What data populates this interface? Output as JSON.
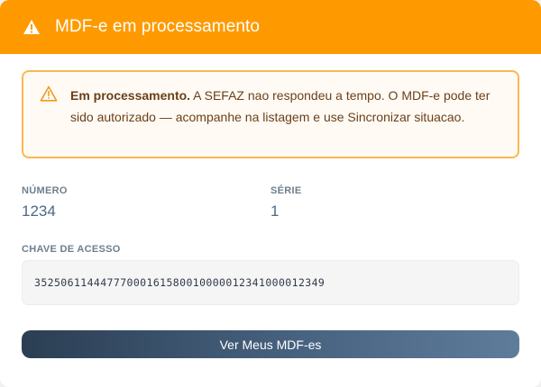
{
  "modal": {
    "title": "MDF-e em processamento",
    "header_icon": "warning-triangle-icon",
    "header_color": "#fe9a00"
  },
  "alert": {
    "icon": "warning-triangle-icon",
    "bold_text": "Em processamento.",
    "message": " A SEFAZ nao respondeu a tempo. O MDF-e pode ter sido autorizado — acompanhe na listagem e use Sincronizar situacao."
  },
  "fields": {
    "numero_label": "NÚMERO",
    "numero_value": "1234",
    "serie_label": "SÉRIE",
    "serie_value": "1",
    "chave_label": "CHAVE DE ACESSO",
    "chave_value": "35250611444777000161580010000012341000012349"
  },
  "actions": {
    "primary_label": "Ver Meus MDF-es"
  }
}
